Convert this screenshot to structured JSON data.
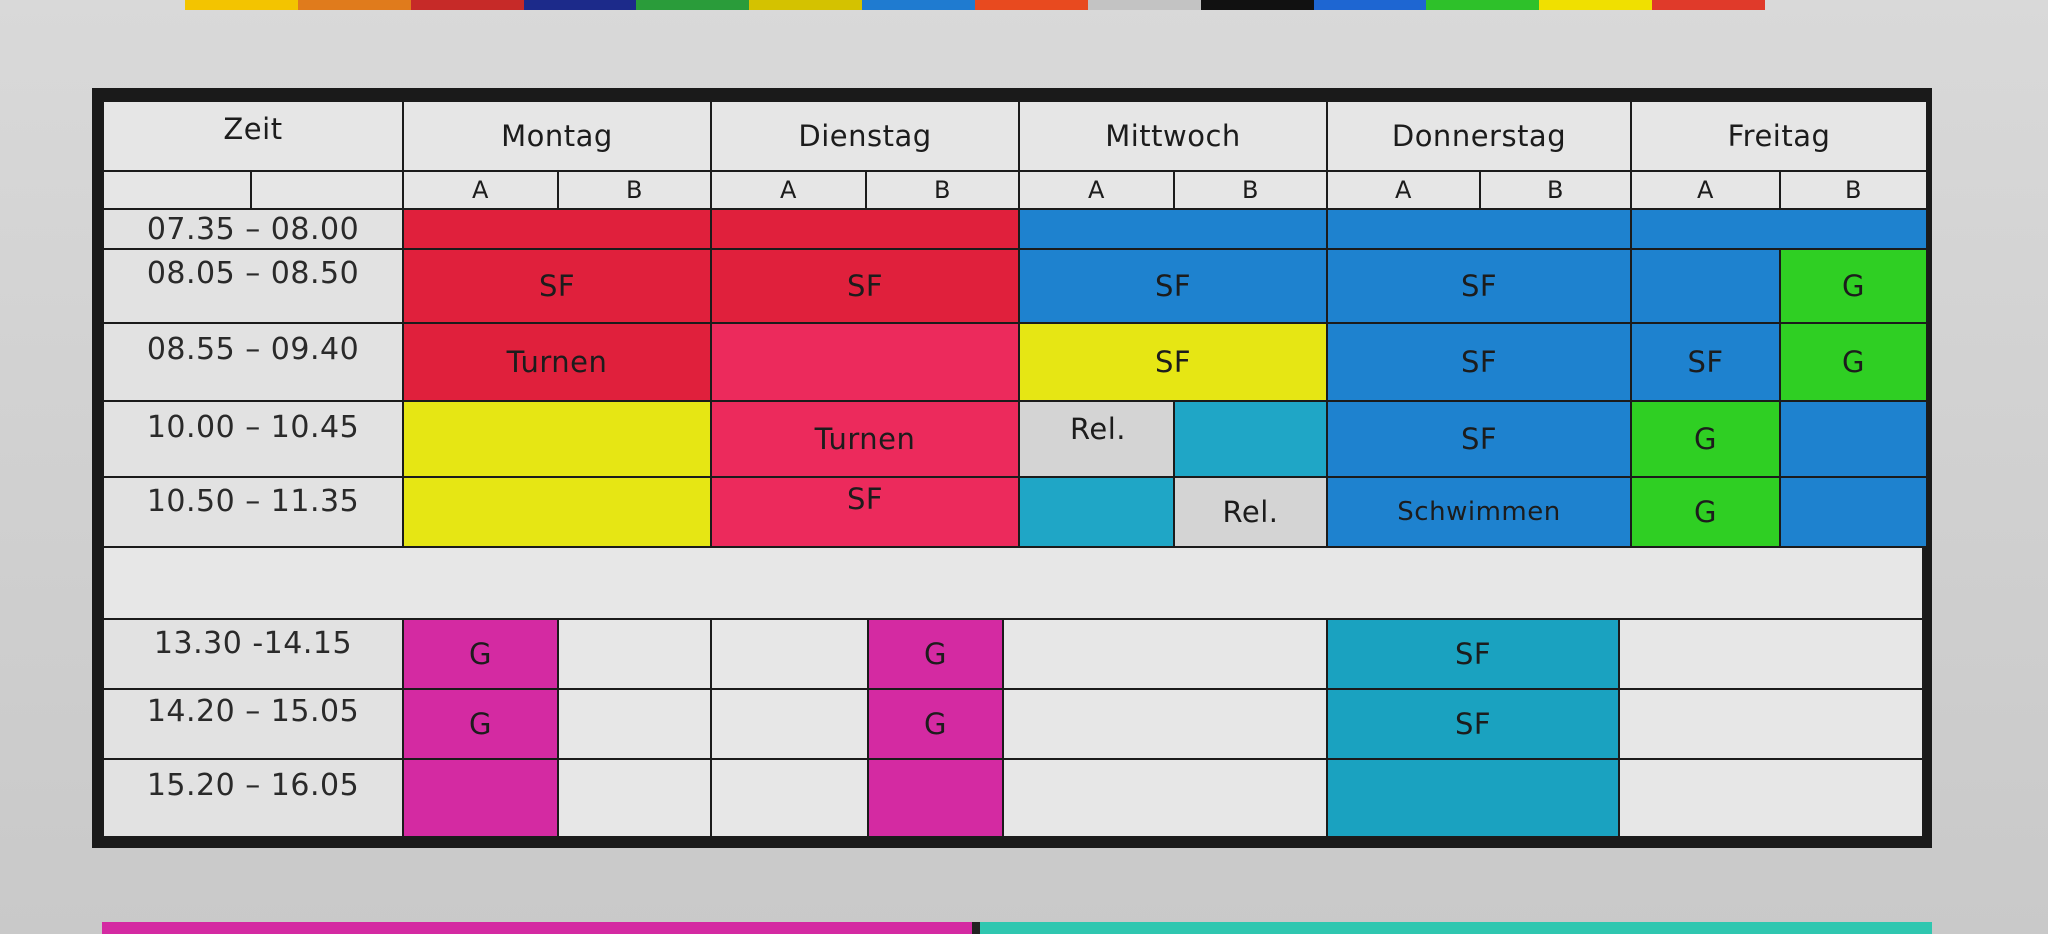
{
  "header": {
    "zeit": "Zeit",
    "days": [
      "Montag",
      "Dienstag",
      "Mittwoch",
      "Donnerstag",
      "Freitag"
    ],
    "sub_a": "A",
    "sub_b": "B"
  },
  "times": [
    "07.35 – 08.00",
    "08.05 – 08.50",
    "08.55 – 09.40",
    "10.00 – 10.45",
    "10.50 – 11.35",
    "13.30 -14.15",
    "14.20 – 15.05",
    "15.20 – 16.05"
  ],
  "subjects": {
    "sf": "SF",
    "turnen": "Turnen",
    "rel": "Rel.",
    "schwimmen": "Schwimmen",
    "g": "G"
  },
  "colors": {
    "red": "#e0203c",
    "pink": "#ec2a5c",
    "blue": "#1e82cf",
    "yellow": "#e6e614",
    "green": "#2fcf23",
    "magenta": "#d42aa2",
    "cyan": "#1fa6c6",
    "grey": "#d4d4d4"
  }
}
